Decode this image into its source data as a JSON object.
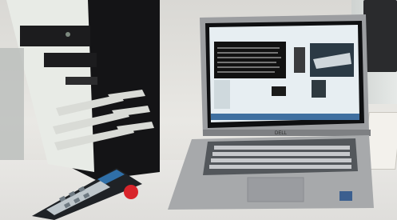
{
  "photo": {
    "objects": [
      "pc-tower",
      "laptop",
      "teach-pendant"
    ],
    "laptop_brand_text": "DELL",
    "colors": {
      "tower_front": "#e9ebe6",
      "tower_body": "#1a1a1c",
      "laptop_body": "#a7a9ab",
      "laptop_screen_bg": "#e7eef2",
      "pendant_body": "#1f2226",
      "pendant_button": "#d8242b",
      "pendant_screen": "#2f6fa8"
    }
  }
}
